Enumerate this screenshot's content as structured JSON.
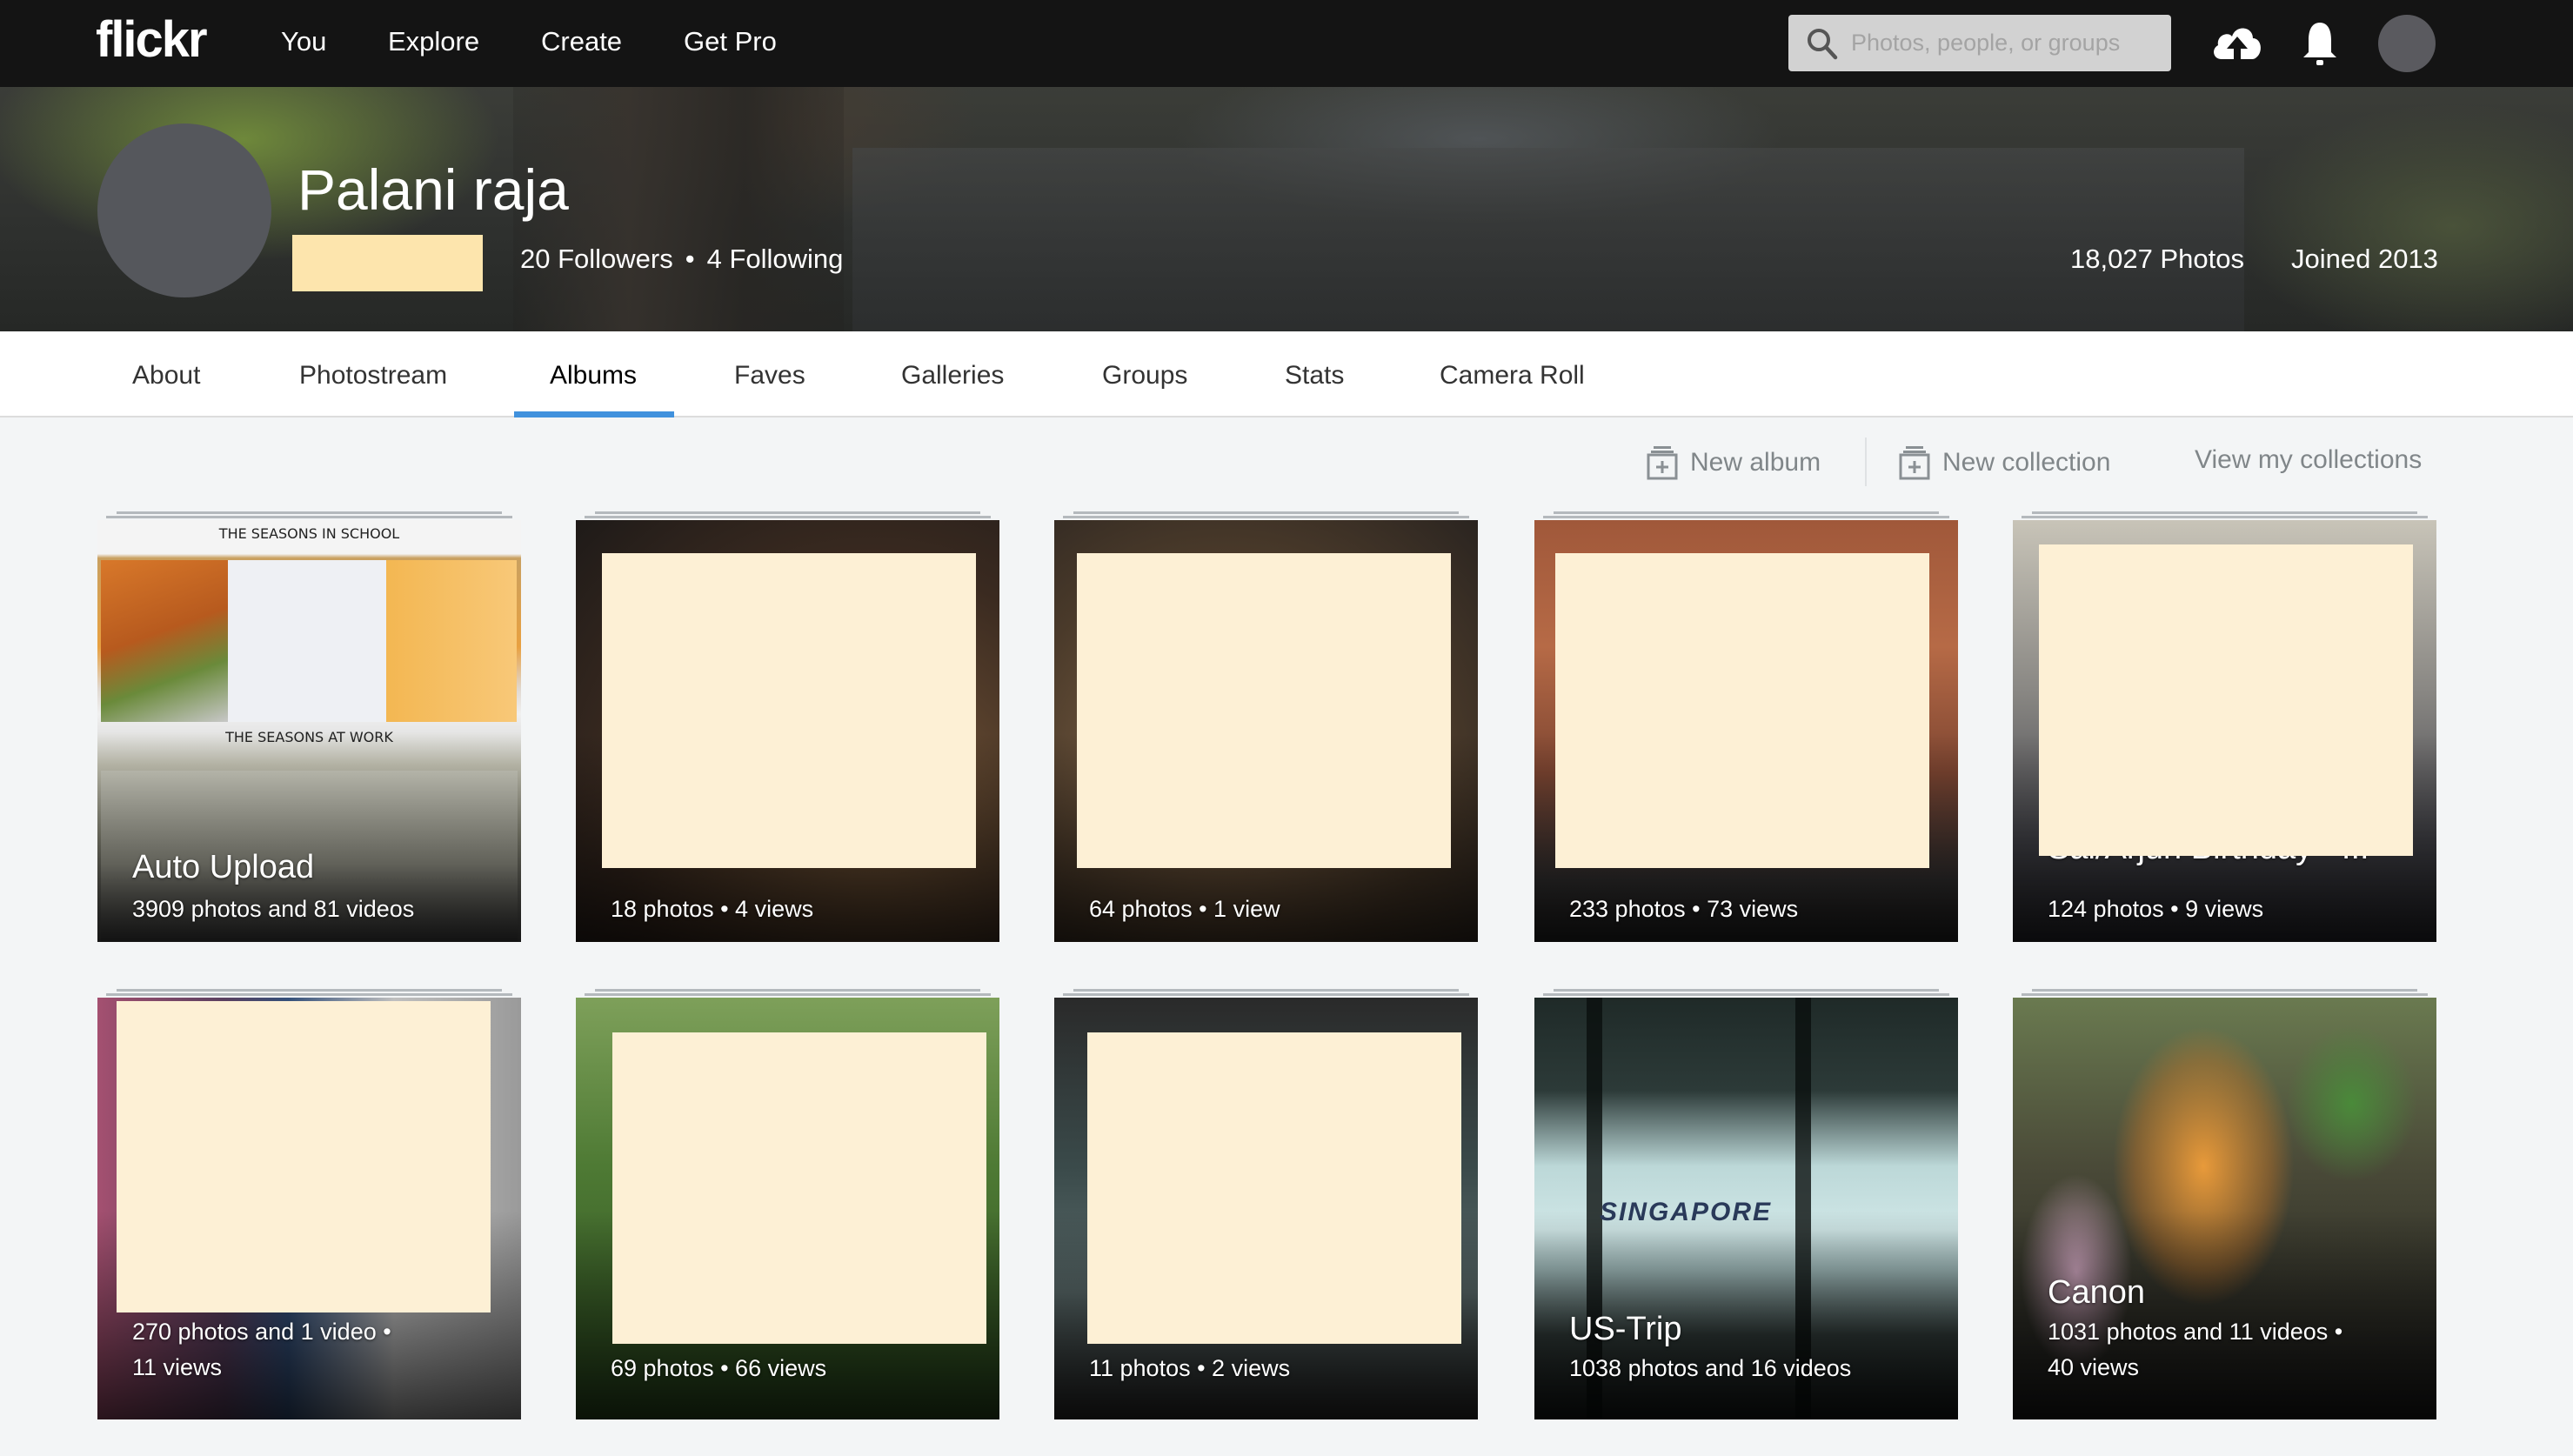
{
  "header": {
    "logo": "flickr",
    "nav": [
      "You",
      "Explore",
      "Create",
      "Get Pro"
    ],
    "search_placeholder": "Photos, people, or groups",
    "icons": [
      "search-icon",
      "upload-cloud-icon",
      "bell-icon",
      "user-avatar"
    ]
  },
  "profile": {
    "name": "Palani raja",
    "followers": "20 Followers",
    "separator": "•",
    "following": "4 Following",
    "photos": "18,027 Photos",
    "joined": "Joined 2013"
  },
  "tabs": [
    {
      "label": "About",
      "active": false
    },
    {
      "label": "Photostream",
      "active": false
    },
    {
      "label": "Albums",
      "active": true
    },
    {
      "label": "Faves",
      "active": false
    },
    {
      "label": "Galleries",
      "active": false
    },
    {
      "label": "Groups",
      "active": false
    },
    {
      "label": "Stats",
      "active": false
    },
    {
      "label": "Camera Roll",
      "active": false
    }
  ],
  "toolbar": {
    "new_album": "New album",
    "new_collection": "New collection",
    "view_collections": "View my collections"
  },
  "albums": [
    {
      "title": "Auto Upload",
      "meta1": "3909 photos and 81 videos",
      "meta2": ""
    },
    {
      "title": "",
      "meta1": "18 photos  •  4 views",
      "meta2": ""
    },
    {
      "title": "",
      "meta1": "64 photos  •  1 view",
      "meta2": ""
    },
    {
      "title": "",
      "meta1": "233 photos  •  73 views",
      "meta2": ""
    },
    {
      "title": "Sai/Arjun Birthday - III",
      "meta1": "124 photos  •  9 views",
      "meta2": ""
    },
    {
      "title": "",
      "meta1": "270 photos and 1 video  •",
      "meta2": "11 views"
    },
    {
      "title": "",
      "meta1": "69 photos  •  66 views",
      "meta2": ""
    },
    {
      "title": "",
      "meta1": "11 photos  •  2 views",
      "meta2": ""
    },
    {
      "title": "US-Trip",
      "meta1": "1038 photos and 16 videos",
      "meta2": ""
    },
    {
      "title": "Canon",
      "meta1": "1031 photos and 11 videos  •",
      "meta2": "40 views"
    }
  ],
  "comic": {
    "top_caption": "THE SEASONS IN SCHOOL",
    "bottom_caption": "THE SEASONS AT WORK"
  },
  "airport_sign": "SINGAPORE",
  "colors": {
    "header_bg": "#141414",
    "accent": "#4091dd",
    "redaction": "#fdf0d5",
    "page_bg": "#f3f5f6"
  }
}
